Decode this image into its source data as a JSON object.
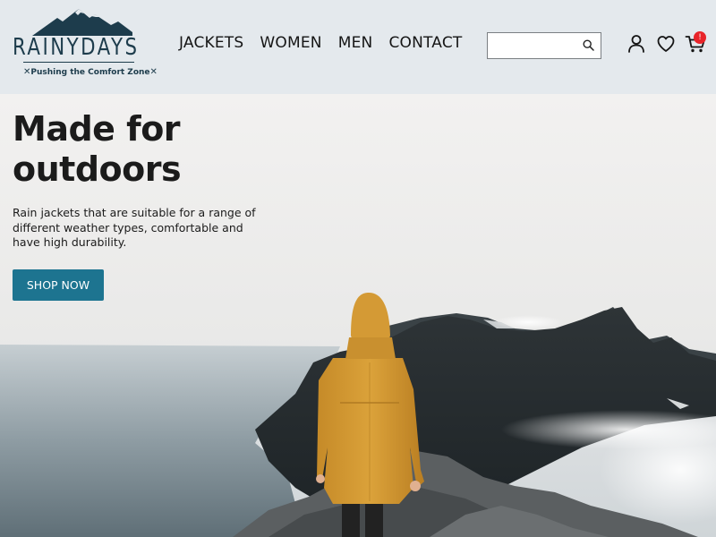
{
  "brand": {
    "name": "RAINYDAYS",
    "tagline": "Pushing the Comfort Zone",
    "colors": {
      "primary": "#1d3c4c",
      "accent": "#1d7490",
      "badge": "#e8242a"
    }
  },
  "nav": {
    "items": [
      {
        "label": "JACKETS"
      },
      {
        "label": "WOMEN"
      },
      {
        "label": "MEN"
      },
      {
        "label": "CONTACT"
      }
    ]
  },
  "search": {
    "value": "",
    "placeholder": "",
    "icon": "search-icon"
  },
  "header_icons": {
    "user": "user-icon",
    "wishlist": "heart-icon",
    "cart": "cart-icon",
    "cart_count": "!"
  },
  "hero": {
    "title_line1": "Made for",
    "title_line2": "outdoors",
    "text": "Rain jackets that are suitable for a range of different weather types, comfortable and have high durability.",
    "cta_label": "SHOP NOW"
  }
}
